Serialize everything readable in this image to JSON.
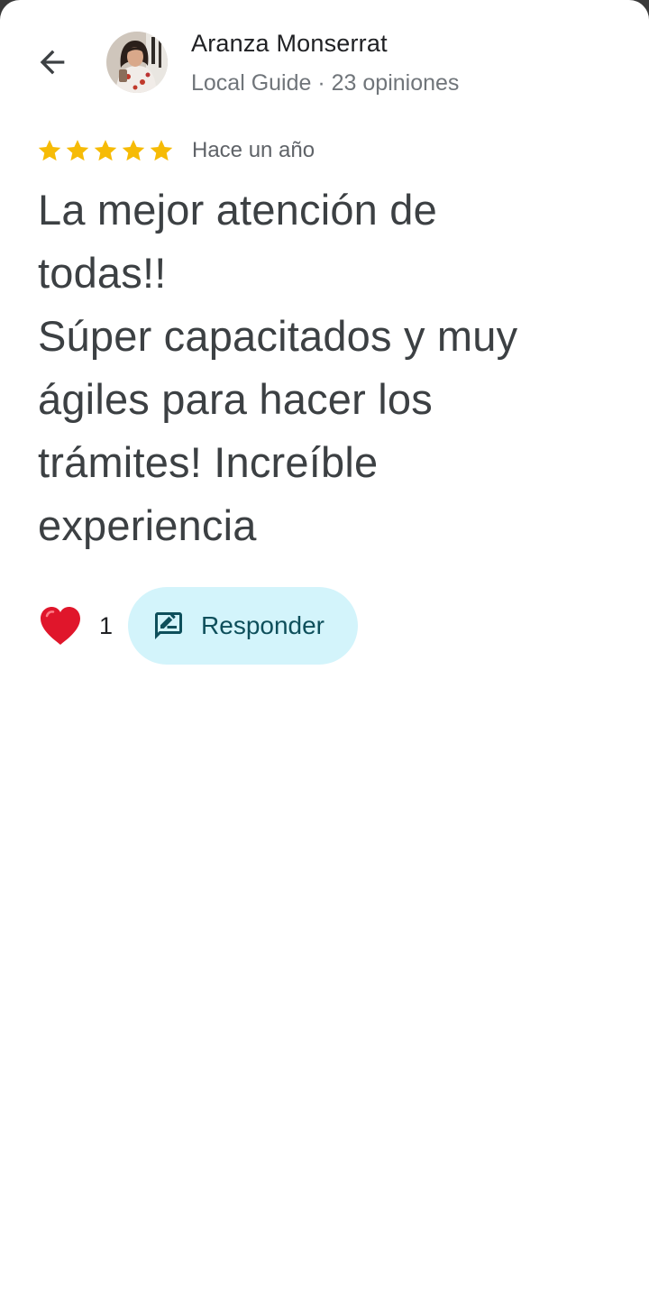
{
  "header": {
    "back_icon": "arrow-back-icon",
    "avatar_icon": "user-avatar",
    "author_name": "Aranza Monserrat",
    "author_meta": "Local Guide · 23 opiniones"
  },
  "review": {
    "rating": 5,
    "rating_max": 5,
    "star_color": "#f6bb06",
    "date": "Hace un año",
    "text_lines": [
      "La mejor atención de",
      "todas!!",
      "Súper capacitados y muy",
      "ágiles para hacer los",
      "trámites! Increíble",
      "experiencia"
    ]
  },
  "actions": {
    "like_icon": "red-heart-icon",
    "like_count": "1",
    "reply_icon": "rate-review-icon",
    "reply_label": "Responder",
    "reply_bg_color": "#d3f4fb",
    "reply_text_color": "#0e4f5b"
  }
}
